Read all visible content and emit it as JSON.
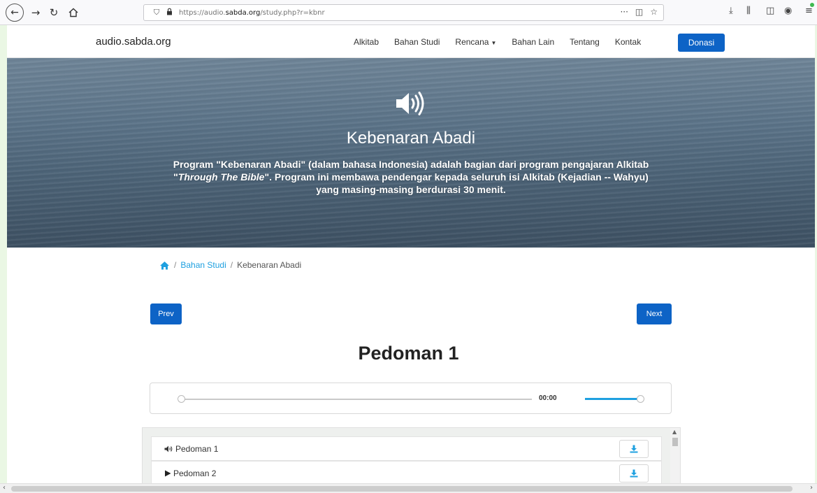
{
  "browser": {
    "url_prefix": "https://audio.",
    "url_domain": "sabda.org",
    "url_path": "/study.php?r=kbnr",
    "menu_dots": "···"
  },
  "navbar": {
    "brand": "audio.sabda.org",
    "links": [
      "Alkitab",
      "Bahan Studi",
      "Rencana",
      "Bahan Lain",
      "Tentang",
      "Kontak"
    ],
    "donate": "Donasi"
  },
  "hero": {
    "title": "Kebenaran Abadi",
    "desc_part1": "Program \"Kebenaran Abadi\" (dalam bahasa Indonesia) adalah bagian dari program pengajaran Alkitab \"",
    "desc_italic": "Through The Bible",
    "desc_part2": "\". Program ini membawa pendengar kepada seluruh isi Alkitab (Kejadian -- Wahyu) yang masing-masing berdurasi 30 menit."
  },
  "breadcrumb": {
    "separator": "/",
    "link": "Bahan Studi",
    "current": "Kebenaran Abadi"
  },
  "pager": {
    "prev": "Prev",
    "next": "Next"
  },
  "page_title": "Pedoman 1",
  "player": {
    "time": "00:00",
    "progress": 0,
    "volume": 1.0
  },
  "playlist": [
    {
      "label": "Pedoman 1",
      "state": "playing"
    },
    {
      "label": "Pedoman 2",
      "state": "paused"
    }
  ],
  "colors": {
    "primary": "#0d63c6",
    "accent": "#1ea0e0"
  }
}
